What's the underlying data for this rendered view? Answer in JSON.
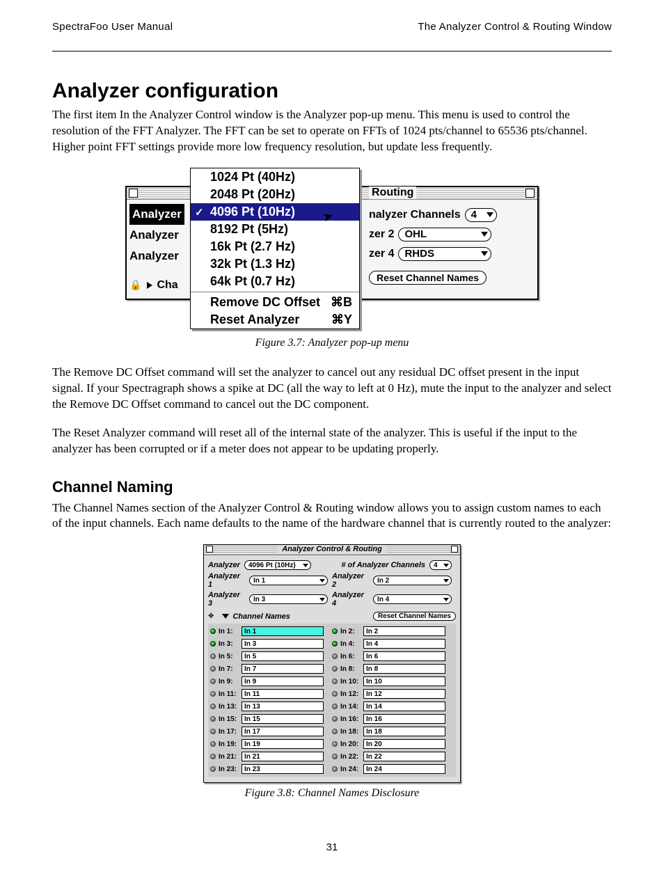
{
  "header": {
    "left": "SpectraFoo User Manual",
    "right": "The Analyzer Control & Routing Window"
  },
  "section_title": "Analyzer configuration",
  "para1": "The first item In the Analyzer Control window is the Analyzer pop-up menu. This menu is used to control the resolution of the FFT Analyzer. The FFT can be set to operate on FFTs of 1024 pts/channel to 65536 pts/channel. Higher point FFT settings provide more low frequency resolution, but update less frequently.",
  "fig1": {
    "caption": "Figure 3.7: Analyzer pop-up menu",
    "menu": {
      "items": [
        {
          "label": "1024 Pt (40Hz)"
        },
        {
          "label": "2048 Pt (20Hz)"
        },
        {
          "label": "4096 Pt (10Hz)",
          "selected": true
        },
        {
          "label": "8192 Pt (5Hz)"
        },
        {
          "label": "16k   Pt (2.7 Hz)"
        },
        {
          "label": "32k   Pt (1.3 Hz)"
        },
        {
          "label": "64k   Pt (0.7 Hz)"
        }
      ],
      "commands": [
        {
          "label": "Remove DC Offset",
          "shortcut": "⌘B"
        },
        {
          "label": "Reset Analyzer",
          "shortcut": "⌘Y"
        }
      ]
    },
    "left_labels": {
      "l1": "Analyzer",
      "l2": "Analyzer",
      "l3": "Analyzer",
      "l4": "Cha"
    },
    "routing": {
      "title": "Routing",
      "channels_label": "nalyzer Channels",
      "channels_value": "4",
      "rows": [
        {
          "label": "zer 2",
          "value": "OHL"
        },
        {
          "label": "zer 4",
          "value": "RHDS"
        }
      ],
      "reset": "Reset Channel Names"
    }
  },
  "para2": "The Remove DC Offset command will set the analyzer to cancel out any residual DC offset present in the input signal. If your Spectragraph shows a spike at DC (all the way to left at 0 Hz), mute the input to the analyzer and select the Remove DC Offset command to cancel out the DC component.",
  "para3": "The Reset Analyzer command will reset all of the internal state of the analyzer. This is useful if the input to the analyzer has been corrupted or if a meter does not appear to be updating properly.",
  "sub_title": "Channel Naming",
  "para4": "The Channel Names section of the Analyzer Control & Routing window allows you to assign custom names to each of the input channels. Each name defaults to the name of the hardware channel that is currently routed to the analyzer:",
  "fig2": {
    "caption": "Figure 3.8: Channel Names Disclosure",
    "title": "Analyzer Control & Routing",
    "top": {
      "analyzer_label": "Analyzer",
      "analyzer_value": "4096 Pt (10Hz)",
      "channels_label": "# of Analyzer Channels",
      "channels_value": "4"
    },
    "assigns": [
      {
        "label": "Analyzer 1",
        "value": "In 1"
      },
      {
        "label": "Analyzer 2",
        "value": "In 2"
      },
      {
        "label": "Analyzer 3",
        "value": "In 3"
      },
      {
        "label": "Analyzer 4",
        "value": "In 4"
      }
    ],
    "chan_header": "Channel Names",
    "reset": "Reset Channel Names",
    "inputs": [
      {
        "label": "In 1:",
        "value": "In 1",
        "active": true,
        "hl": true
      },
      {
        "label": "In 2:",
        "value": "In 2",
        "active": true
      },
      {
        "label": "In 3:",
        "value": "In 3",
        "active": true
      },
      {
        "label": "In 4:",
        "value": "In 4",
        "active": true
      },
      {
        "label": "In 5:",
        "value": "In 5"
      },
      {
        "label": "In 6:",
        "value": "In 6"
      },
      {
        "label": "In 7:",
        "value": "In 7"
      },
      {
        "label": "In 8:",
        "value": "In 8"
      },
      {
        "label": "In 9:",
        "value": "In 9"
      },
      {
        "label": "In 10:",
        "value": "In 10"
      },
      {
        "label": "In 11:",
        "value": "In 11"
      },
      {
        "label": "In 12:",
        "value": "In 12"
      },
      {
        "label": "In 13:",
        "value": "In 13"
      },
      {
        "label": "In 14:",
        "value": "In 14"
      },
      {
        "label": "In 15:",
        "value": "In 15"
      },
      {
        "label": "In 16:",
        "value": "In 16"
      },
      {
        "label": "In 17:",
        "value": "In 17"
      },
      {
        "label": "In 18:",
        "value": "In 18"
      },
      {
        "label": "In 19:",
        "value": "In 19"
      },
      {
        "label": "In 20:",
        "value": "In 20"
      },
      {
        "label": "In 21:",
        "value": "In 21"
      },
      {
        "label": "In 22:",
        "value": "In 22"
      },
      {
        "label": "In 23:",
        "value": "In 23"
      },
      {
        "label": "In 24:",
        "value": "In 24"
      }
    ]
  },
  "page_number": "31"
}
